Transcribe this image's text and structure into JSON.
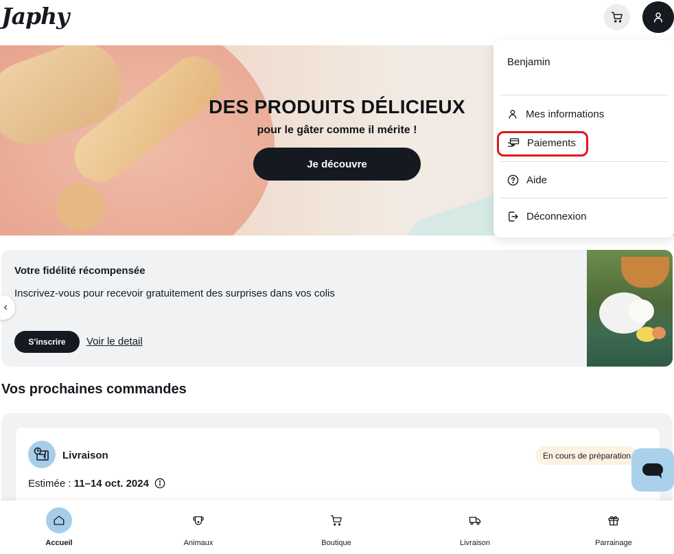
{
  "header": {
    "logo": "Japhy",
    "cart_icon": "cart-icon",
    "user_icon": "user-icon"
  },
  "hero": {
    "title": "DES PRODUITS DÉLICIEUX",
    "subtitle": "pour le gâter comme il mérite !",
    "button_label": "Je découvre"
  },
  "user_menu": {
    "name": "Benjamin",
    "items": [
      {
        "label": "Mes informations",
        "icon": "user-icon"
      },
      {
        "label": "Paiements",
        "icon": "payment-icon"
      },
      {
        "label": "Aide",
        "icon": "help-icon"
      },
      {
        "label": "Déconnexion",
        "icon": "logout-icon"
      }
    ],
    "highlighted_item": "Paiements",
    "highlight_color": "#e2131e"
  },
  "loyalty": {
    "title": "Votre fidélité récompensée",
    "text": "Inscrivez-vous pour recevoir gratuitement des surprises dans vos colis",
    "button_label": "S'inscrire",
    "link_label": "Voir le detail"
  },
  "orders": {
    "title": "Vos prochaines commandes",
    "card": {
      "label": "Livraison",
      "status": "En cours de préparation",
      "estimate_prefix": "Estimée : ",
      "estimate_dates": "11–14 oct. 2024"
    }
  },
  "bottom_nav": {
    "items": [
      {
        "label": "Accueil",
        "icon": "home-icon",
        "active": true
      },
      {
        "label": "Animaux",
        "icon": "dog-icon",
        "active": false
      },
      {
        "label": "Boutique",
        "icon": "cart-icon",
        "active": false
      },
      {
        "label": "Livraison",
        "icon": "truck-icon",
        "active": false
      },
      {
        "label": "Parrainage",
        "icon": "gift-icon",
        "active": false
      }
    ]
  },
  "colors": {
    "dark": "#151a21",
    "accent_blue": "#a6cdea",
    "card_bg": "#f1f2f4",
    "badge_bg": "#fdf1e3"
  }
}
